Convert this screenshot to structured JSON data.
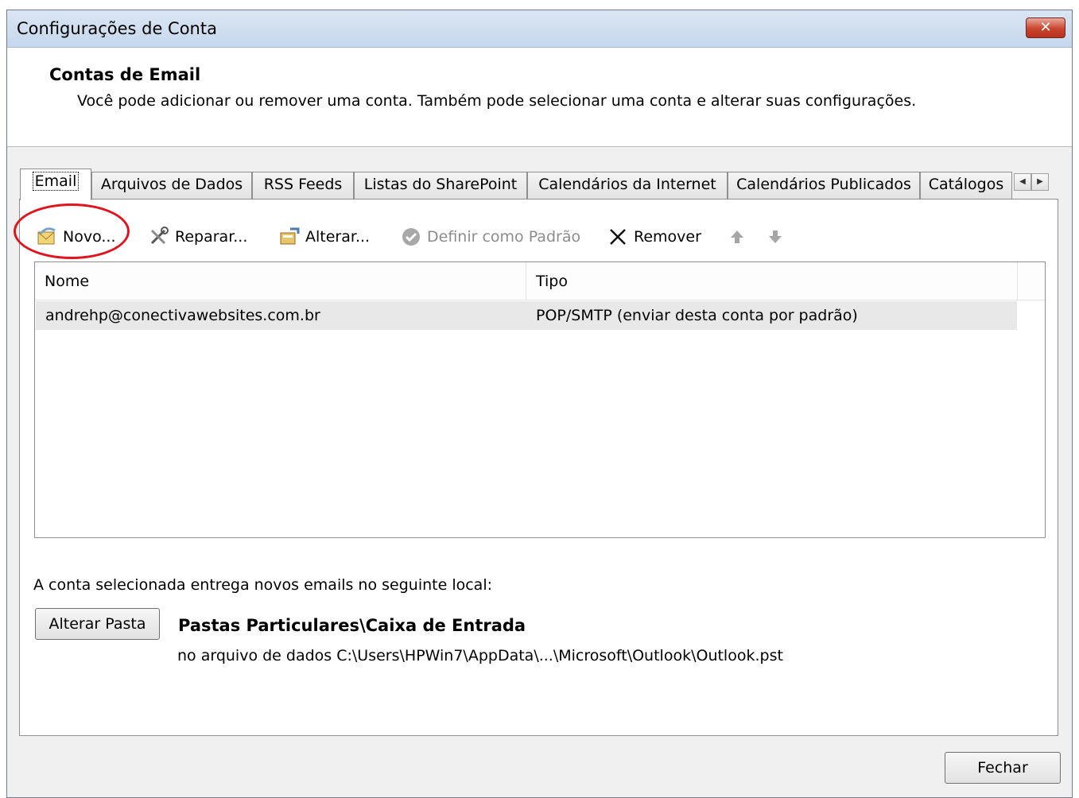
{
  "window": {
    "title": "Configurações de Conta",
    "close_label": "✕"
  },
  "header": {
    "title": "Contas de Email",
    "description": "Você pode adicionar ou remover uma conta. Também pode selecionar uma conta e alterar suas configurações."
  },
  "tabs": [
    {
      "label": "Email",
      "active": true
    },
    {
      "label": "Arquivos de Dados"
    },
    {
      "label": "RSS Feeds"
    },
    {
      "label": "Listas do SharePoint"
    },
    {
      "label": "Calendários da Internet"
    },
    {
      "label": "Calendários Publicados"
    },
    {
      "label": "Catálogos"
    }
  ],
  "tab_scroll": {
    "left": "◀",
    "right": "▶"
  },
  "toolbar": {
    "novo": "Novo...",
    "reparar": "Reparar...",
    "alterar": "Alterar...",
    "definir_padrao": "Definir como Padrão",
    "remover": "Remover"
  },
  "list": {
    "columns": [
      "Nome",
      "Tipo"
    ],
    "rows": [
      {
        "nome": "andrehp@conectivawebsites.com.br",
        "tipo": "POP/SMTP (enviar desta conta por padrão)"
      }
    ]
  },
  "delivery": {
    "label": "A conta selecionada entrega novos emails no seguinte local:",
    "change_folder_button": "Alterar Pasta",
    "folder": "Pastas Particulares\\Caixa de Entrada",
    "path": "no arquivo de dados C:\\Users\\HPWin7\\AppData\\...\\Microsoft\\Outlook\\Outlook.pst"
  },
  "footer": {
    "close_button": "Fechar"
  },
  "colors": {
    "highlight_circle": "#e0141e",
    "title_gradient_top": "#dbe6f3",
    "close_red": "#c8442f"
  }
}
